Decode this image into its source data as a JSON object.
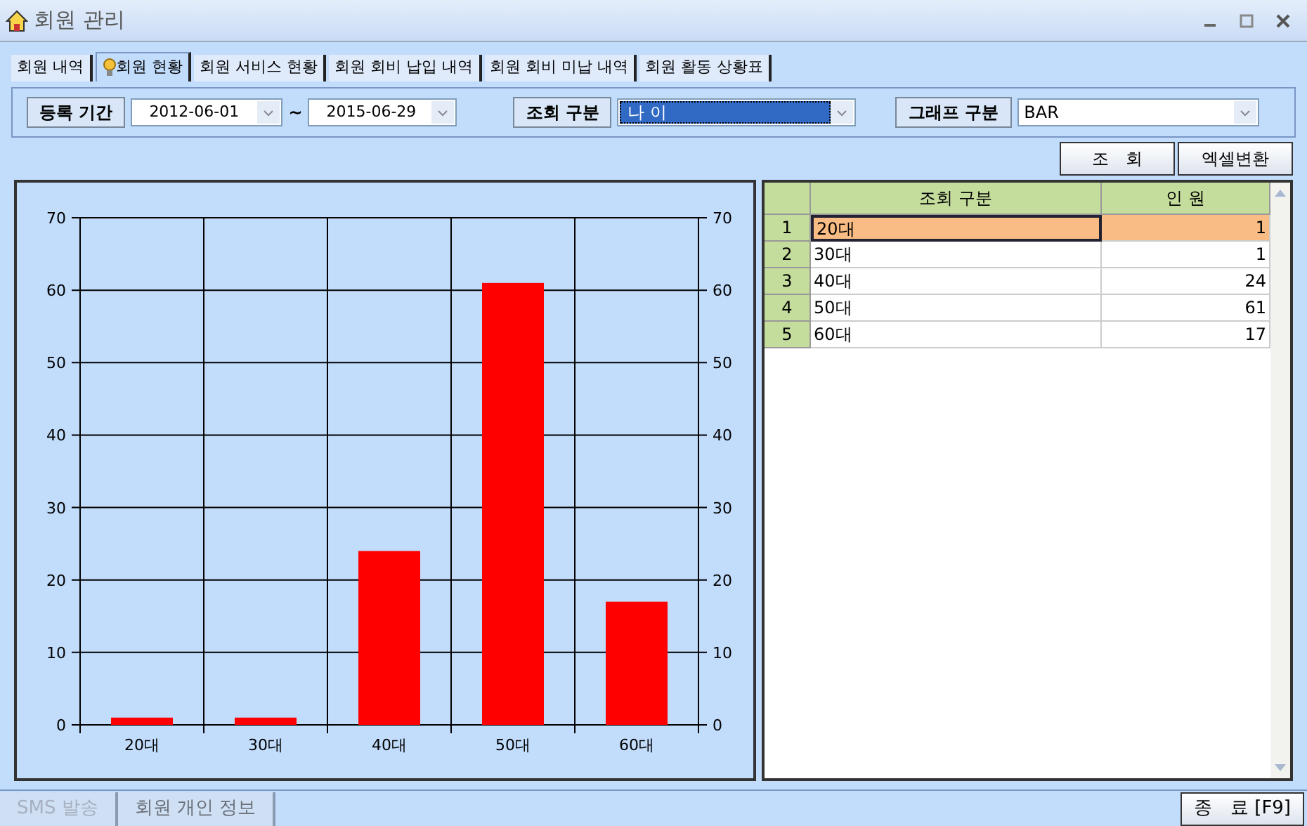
{
  "window": {
    "title": "회원 관리"
  },
  "tabs": [
    {
      "label": "회원 내역",
      "selected": false
    },
    {
      "label": "회원 현황",
      "selected": true
    },
    {
      "label": "회원 서비스 현황",
      "selected": false
    },
    {
      "label": "회원 회비 납입 내역",
      "selected": false
    },
    {
      "label": "회원 회비 미납 내역",
      "selected": false
    },
    {
      "label": "회원 활동 상황표",
      "selected": false
    }
  ],
  "filters": {
    "period_label": "등록 기간",
    "start_date": "2012-06-01",
    "separator": "~",
    "end_date": "2015-06-29",
    "query_label": "조회 구분",
    "query_value": "나 이",
    "graph_label": "그래프 구분",
    "graph_value": "BAR"
  },
  "buttons": [
    "조　회",
    "엑셀변환"
  ],
  "chart_data": {
    "type": "bar",
    "categories": [
      "20대",
      "30대",
      "40대",
      "50대",
      "60대"
    ],
    "series": [
      {
        "color": "#ff0000",
        "values": [
          1,
          1,
          24,
          61,
          17
        ]
      }
    ],
    "ylim": [
      0,
      70
    ],
    "yticks": [
      0,
      10,
      20,
      30,
      40,
      50,
      60,
      70
    ],
    "y2lim": [
      0,
      70
    ],
    "y2ticks": [
      0,
      10,
      20,
      30,
      40,
      50,
      60,
      70
    ],
    "grid": true
  },
  "table": {
    "columns": [
      "조회 구분",
      "인 원"
    ],
    "rows": [
      {
        "number": "1",
        "cells": [
          "20대",
          "1"
        ],
        "selected": true
      },
      {
        "number": "2",
        "cells": [
          "30대",
          "1"
        ],
        "selected": false
      },
      {
        "number": "3",
        "cells": [
          "40대",
          "24"
        ],
        "selected": false
      },
      {
        "number": "4",
        "cells": [
          "50대",
          "61"
        ],
        "selected": false
      },
      {
        "number": "5",
        "cells": [
          "60대",
          "17"
        ],
        "selected": false
      }
    ]
  },
  "footer": {
    "left_buttons": [
      {
        "label": "SMS 발송",
        "disabled": true
      },
      {
        "label": "회원 개인 정보",
        "disabled": false
      }
    ],
    "close_button": "종　료 [F9]"
  }
}
